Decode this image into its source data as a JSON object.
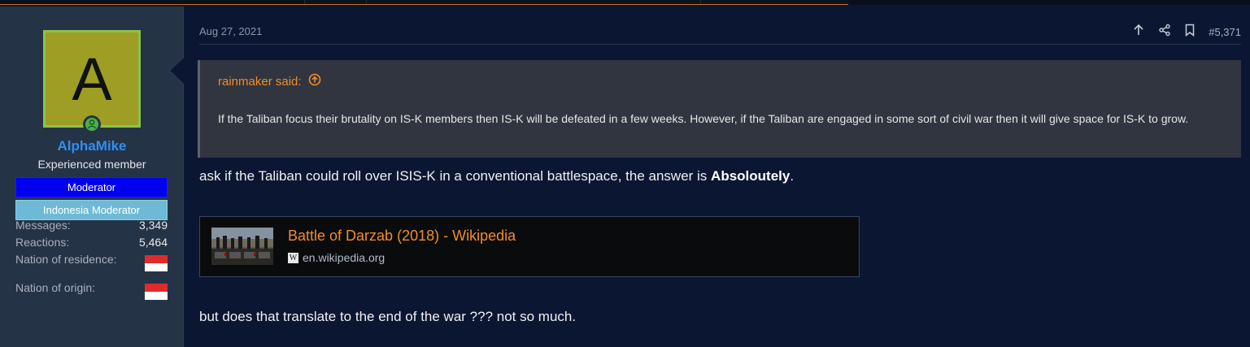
{
  "user": {
    "avatar_letter": "A",
    "name": "AlphaMike",
    "title": "Experienced member",
    "banners": [
      "Moderator",
      "Indonesia Moderator"
    ],
    "stats": {
      "messages_label": "Messages:",
      "messages": "3,349",
      "reactions_label": "Reactions:",
      "reactions": "5,464",
      "residence_label": "Nation of residence:",
      "origin_label": "Nation of origin:"
    },
    "colors": {
      "name": "#2f8ff5",
      "avatar_bg": "#9e9d24",
      "moderator_banner": "#0000ee",
      "indonesia_banner": "#6eb9d6"
    },
    "icons": {
      "online": "online-status-icon",
      "residence_flag": "indonesia-flag-icon",
      "origin_flag": "indonesia-flag-icon"
    }
  },
  "post": {
    "date": "Aug 27, 2021",
    "number": "#5,371",
    "action_icons": [
      "upvote-arrow-icon",
      "share-icon",
      "bookmark-icon"
    ],
    "quote": {
      "author": "rainmaker said:",
      "icon": "jump-to-quote-icon",
      "text": "If the Taliban focus their brutality on IS-K members then IS-K will be defeated in a few weeks. However, if the Taliban are engaged in some sort of civil war then it will give space for IS-K to grow."
    },
    "paragraph1_text": "ask if the Taliban could roll over ISIS-K in a conventional battlespace, the answer is ",
    "paragraph1_bold": "Absoloutely",
    "paragraph1_end": ".",
    "link": {
      "title": "Battle of Darzab (2018) - Wikipedia",
      "domain": "en.wikipedia.org",
      "favicon": "wikipedia-icon"
    },
    "paragraph2": "but does that translate to the end of the war ??? not so much."
  },
  "theme": {
    "accent": "#f28c28",
    "background": "#0b1732",
    "sidebar": "#253347"
  }
}
